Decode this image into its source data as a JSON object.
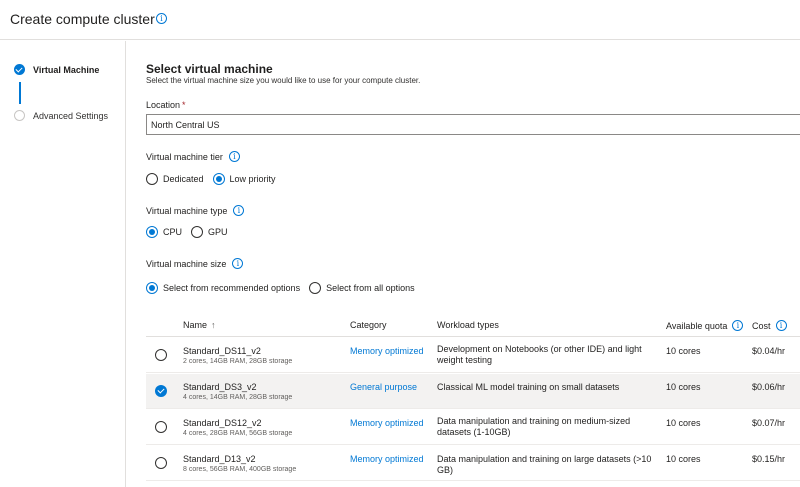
{
  "header": {
    "title": "Create compute cluster",
    "info_icon": "info-icon"
  },
  "steps": [
    {
      "label": "Virtual Machine",
      "state": "done"
    },
    {
      "label": "Advanced Settings",
      "state": "todo"
    }
  ],
  "section": {
    "title": "Select virtual machine",
    "description": "Select the virtual machine size you would like to use for your compute cluster."
  },
  "location": {
    "label": "Location",
    "required_mark": "*",
    "value": "North Central US"
  },
  "tier": {
    "label": "Virtual machine tier",
    "options": [
      "Dedicated",
      "Low priority"
    ],
    "selected": "Low priority"
  },
  "vm_type": {
    "label": "Virtual machine type",
    "options": [
      "CPU",
      "GPU"
    ],
    "selected": "CPU"
  },
  "vm_size": {
    "label": "Virtual machine size",
    "options": [
      "Select from recommended options",
      "Select from all options"
    ],
    "selected": "Select from recommended options"
  },
  "table": {
    "columns": {
      "name": "Name",
      "sort_glyph": "↑",
      "category": "Category",
      "workload": "Workload types",
      "quota": "Available quota",
      "cost": "Cost"
    },
    "rows": [
      {
        "name": "Standard_DS11_v2",
        "spec": "2 cores, 14GB RAM, 28GB storage",
        "category": "Memory optimized",
        "workload": "Development on Notebooks (or other IDE) and light weight testing",
        "quota": "10 cores",
        "cost": "$0.04/hr",
        "selected": false
      },
      {
        "name": "Standard_DS3_v2",
        "spec": "4 cores, 14GB RAM, 28GB storage",
        "category": "General purpose",
        "workload": "Classical ML model training on small datasets",
        "quota": "10 cores",
        "cost": "$0.06/hr",
        "selected": true
      },
      {
        "name": "Standard_DS12_v2",
        "spec": "4 cores, 28GB RAM, 56GB storage",
        "category": "Memory optimized",
        "workload": "Data manipulation and training on medium-sized datasets (1-10GB)",
        "quota": "10 cores",
        "cost": "$0.07/hr",
        "selected": false
      },
      {
        "name": "Standard_D13_v2",
        "spec": "8 cores, 56GB RAM, 400GB storage",
        "category": "Memory optimized",
        "workload": "Data manipulation and training on large datasets (>10 GB)",
        "quota": "10 cores",
        "cost": "$0.15/hr",
        "selected": false
      }
    ]
  },
  "colors": {
    "accent": "#0078d4",
    "border": "#e1dfdd",
    "selected_row": "#f3f2f1",
    "required": "#a4262c"
  }
}
